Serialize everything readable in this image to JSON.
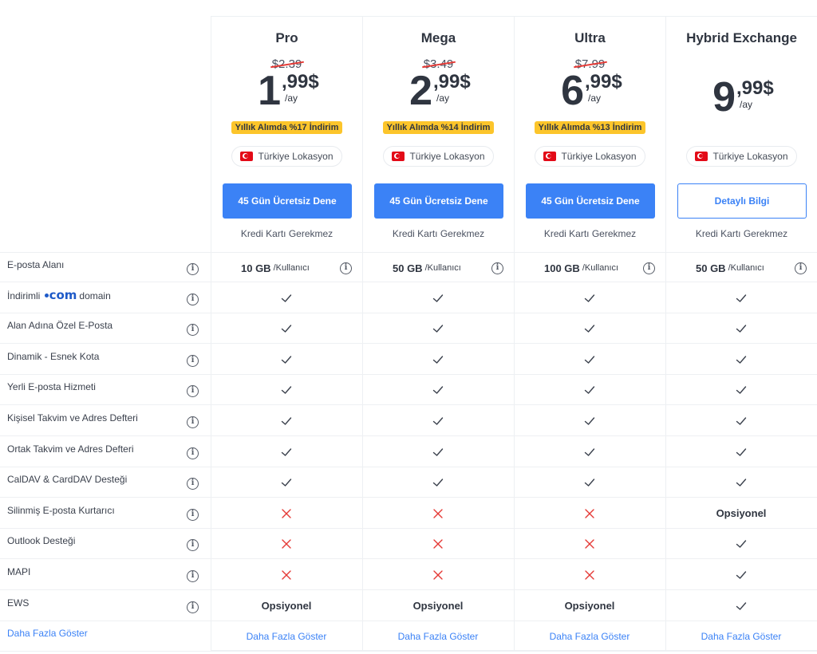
{
  "plans": [
    {
      "name": "Pro",
      "old_price": "$2.39",
      "price_int": "1",
      "price_dec": ",99$",
      "price_per": "/ay",
      "discount": "Yıllık Alımda %17 İndirim",
      "location": "Türkiye Lokasyon",
      "cta": "45 Gün Ücretsiz Dene",
      "note": "Kredi Kartı Gerekmez",
      "quota": "10 GB",
      "quota_unit": "/Kullanıcı",
      "more": "Daha Fazla Göster"
    },
    {
      "name": "Mega",
      "old_price": "$3.49",
      "price_int": "2",
      "price_dec": ",99$",
      "price_per": "/ay",
      "discount": "Yıllık Alımda %14 İndirim",
      "location": "Türkiye Lokasyon",
      "cta": "45 Gün Ücretsiz Dene",
      "note": "Kredi Kartı Gerekmez",
      "quota": "50 GB",
      "quota_unit": "/Kullanıcı",
      "more": "Daha Fazla Göster"
    },
    {
      "name": "Ultra",
      "old_price": "$7.99",
      "price_int": "6",
      "price_dec": ",99$",
      "price_per": "/ay",
      "discount": "Yıllık Alımda %13 İndirim",
      "location": "Türkiye Lokasyon",
      "cta": "45 Gün Ücretsiz Dene",
      "note": "Kredi Kartı Gerekmez",
      "quota": "100 GB",
      "quota_unit": "/Kullanıcı",
      "more": "Daha Fazla Göster"
    },
    {
      "name": "Hybrid Exchange",
      "price_int": "9",
      "price_dec": ",99$",
      "price_per": "/ay",
      "location": "Türkiye Lokasyon",
      "cta": "Detaylı Bilgi",
      "note": "Kredi Kartı Gerekmez",
      "quota": "50 GB",
      "quota_unit": "/Kullanıcı",
      "more": "Daha Fazla Göster"
    }
  ],
  "features": {
    "email_space": "E-posta Alanı",
    "discounted_prefix": "İndirimli",
    "com_logo": "com",
    "discounted_suffix": "domain",
    "custom_domain_email": "Alan Adına Özel E-Posta",
    "dynamic_quota": "Dinamik - Esnek Kota",
    "local_email": "Yerli E-posta Hizmeti",
    "personal_calendar": "Kişisel Takvim ve Adres Defteri",
    "shared_calendar": "Ortak Takvim ve Adres Defteri",
    "caldav": "CalDAV & CardDAV Desteği",
    "deleted_recovery": "Silinmiş E-posta Kurtarıcı",
    "outlook": "Outlook Desteği",
    "mapi": "MAPI",
    "ews": "EWS",
    "more": "Daha Fazla Göster"
  },
  "optional_label": "Opsiyonel",
  "info_glyph": "i",
  "matrix": [
    [
      "check",
      "check",
      "check",
      "check"
    ],
    [
      "check",
      "check",
      "check",
      "check"
    ],
    [
      "check",
      "check",
      "check",
      "check"
    ],
    [
      "check",
      "check",
      "check",
      "check"
    ],
    [
      "check",
      "check",
      "check",
      "check"
    ],
    [
      "check",
      "check",
      "check",
      "check"
    ],
    [
      "check",
      "check",
      "check",
      "check"
    ],
    [
      "cross",
      "cross",
      "cross",
      "optional"
    ],
    [
      "cross",
      "cross",
      "cross",
      "check"
    ],
    [
      "cross",
      "cross",
      "cross",
      "check"
    ],
    [
      "optional",
      "optional",
      "optional",
      "check"
    ]
  ],
  "colors": {
    "accent": "#3b82f6",
    "badge": "#fcc52b",
    "cross": "#e53935",
    "text": "#2f3540"
  },
  "icons": [
    "info-icon",
    "check-icon",
    "cross-icon",
    "turkey-flag-icon"
  ]
}
